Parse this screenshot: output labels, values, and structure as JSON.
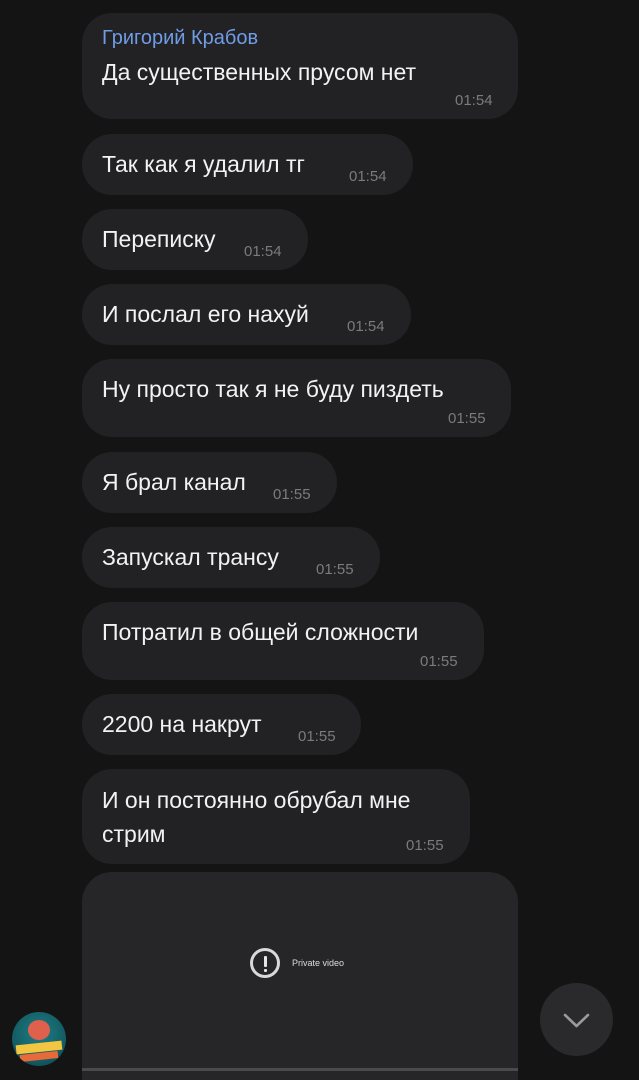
{
  "chat": {
    "sender_name": "Григорий Крабов",
    "messages": [
      {
        "text": "Да существенных прусом нет",
        "time": "01:54"
      },
      {
        "text": "Так как я удалил тг",
        "time": "01:54"
      },
      {
        "text": "Переписку",
        "time": "01:54"
      },
      {
        "text": "И послал его нахуй",
        "time": "01:54"
      },
      {
        "text": "Ну просто так я не буду пиздеть",
        "time": "01:55"
      },
      {
        "text": "Я брал канал",
        "time": "01:55"
      },
      {
        "text": "Запускал трансу",
        "time": "01:55"
      },
      {
        "text": "Потратил в общей сложности",
        "time": "01:55"
      },
      {
        "text": "2200 на накрут",
        "time": "01:55"
      },
      {
        "text": "И он постоянно обрубал мне",
        "text_line2": "стрим",
        "time": "01:55"
      }
    ],
    "video": {
      "status_label": "Private video",
      "icon": "exclamation-circle-icon"
    },
    "avatar": {
      "icon": "avatar-image"
    },
    "scroll_down": {
      "icon": "chevron-down-icon"
    }
  },
  "colors": {
    "background": "#141414",
    "bubble": "#222224",
    "sender_name": "#6f9ce6",
    "timestamp": "#7b7b7d",
    "text": "#f2f2f2"
  }
}
